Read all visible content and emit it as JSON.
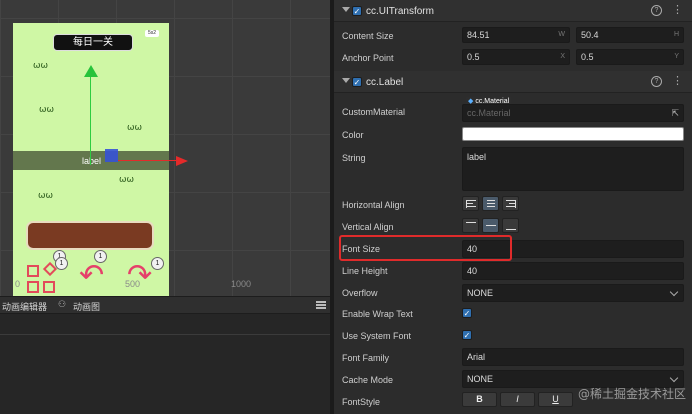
{
  "scene": {
    "title_pill": "每日一关",
    "badge": "5s2",
    "label_text": "label",
    "circle_nums": [
      "1",
      "1",
      "1",
      "1"
    ],
    "axis_labels": [
      "0",
      "500",
      "1000"
    ]
  },
  "anim_panel": {
    "tabs": [
      {
        "label": "动画编辑器",
        "icon": "film-icon"
      },
      {
        "label": "动画图",
        "icon": "graph-icon"
      }
    ]
  },
  "inspector": {
    "ui_transform": {
      "title": "cc.UITransform",
      "content_size": {
        "label": "Content Size",
        "w": "84.51",
        "h": "50.4",
        "w_unit": "W",
        "h_unit": "H"
      },
      "anchor_point": {
        "label": "Anchor Point",
        "x": "0.5",
        "y": "0.5",
        "x_unit": "X",
        "y_unit": "Y"
      }
    },
    "label": {
      "title": "cc.Label",
      "custom_material": {
        "label": "CustomMaterial",
        "tag": "cc.Material",
        "placeholder": "cc.Material"
      },
      "color": {
        "label": "Color",
        "value": "#ffffff"
      },
      "string": {
        "label": "String",
        "value": "label"
      },
      "horizontal_align": {
        "label": "Horizontal Align"
      },
      "vertical_align": {
        "label": "Vertical Align"
      },
      "font_size": {
        "label": "Font Size",
        "value": "40"
      },
      "line_height": {
        "label": "Line Height",
        "value": "40"
      },
      "overflow": {
        "label": "Overflow",
        "value": "NONE"
      },
      "enable_wrap_text": {
        "label": "Enable Wrap Text",
        "checked": true
      },
      "use_system_font": {
        "label": "Use System Font",
        "checked": true
      },
      "font_family": {
        "label": "Font Family",
        "value": "Arial"
      },
      "cache_mode": {
        "label": "Cache Mode",
        "value": "NONE"
      },
      "font_style": {
        "label": "FontStyle",
        "buttons": [
          "B",
          "I",
          "U"
        ]
      }
    },
    "watermark": "@稀土掘金技术社区"
  },
  "colors": {
    "highlight": "#e02b2b",
    "accent": "#2f6fb0",
    "scene_bg": "#cff7a5"
  }
}
